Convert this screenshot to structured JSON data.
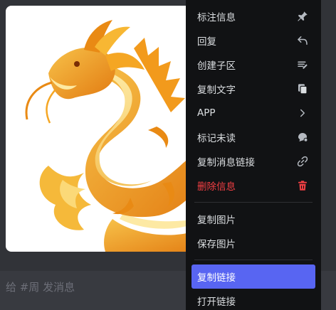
{
  "chat": {
    "input_placeholder": "给 #周 发消息"
  },
  "context_menu": {
    "items": [
      {
        "label": "标注信息",
        "icon": "pin-icon"
      },
      {
        "label": "回复",
        "icon": "reply-icon"
      },
      {
        "label": "创建子区",
        "icon": "thread-icon"
      },
      {
        "label": "复制文字",
        "icon": "copy-text-icon"
      },
      {
        "label": "APP",
        "icon": "chevron-right-icon"
      },
      {
        "label": "标记未读",
        "icon": "mark-unread-icon"
      },
      {
        "label": "复制消息链接",
        "icon": "link-icon"
      },
      {
        "label": "删除信息",
        "icon": "trash-icon",
        "danger": true
      },
      {
        "label": "复制图片",
        "icon": ""
      },
      {
        "label": "保存图片",
        "icon": ""
      },
      {
        "label": "复制链接",
        "icon": "",
        "active": true
      },
      {
        "label": "打开链接",
        "icon": ""
      }
    ]
  },
  "colors": {
    "menu_bg": "#111214",
    "active_bg": "#5865f2",
    "danger": "#f23f43",
    "chat_bg": "#313338"
  }
}
